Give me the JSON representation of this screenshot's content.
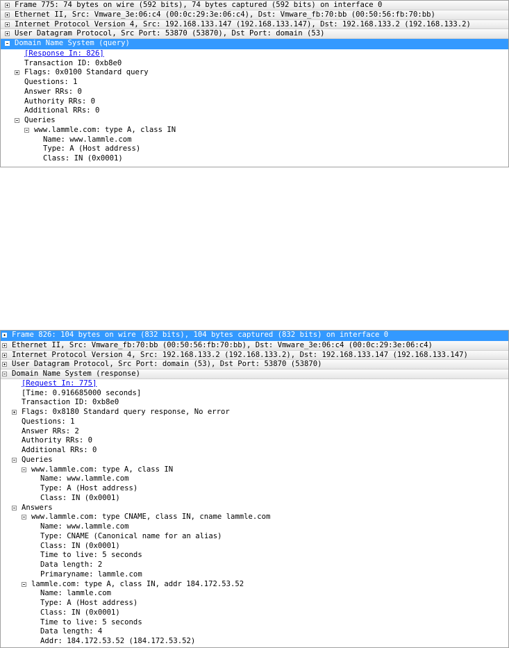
{
  "colors": {
    "selection": "#3399ff",
    "link": "#0000ee"
  },
  "icons": {
    "expand": "plus-box-icon",
    "collapse": "minus-box-icon"
  },
  "pane1": {
    "rows": [
      {
        "text": "Frame 775: 74 bytes on wire (592 bits), 74 bytes captured (592 bits) on interface 0"
      },
      {
        "text": "Ethernet II, Src: Vmware_3e:06:c4 (00:0c:29:3e:06:c4), Dst: Vmware_fb:70:bb (00:50:56:fb:70:bb)"
      },
      {
        "text": "Internet Protocol Version 4, Src: 192.168.133.147 (192.168.133.147), Dst: 192.168.133.2 (192.168.133.2)"
      },
      {
        "text": "User Datagram Protocol, Src Port: 53870 (53870), Dst Port: domain (53)"
      },
      {
        "text": "Domain Name System (query)"
      },
      {
        "text": "[Response In: 826]"
      },
      {
        "text": "Transaction ID: 0xb8e0"
      },
      {
        "text": "Flags: 0x0100 Standard query"
      },
      {
        "text": "Questions: 1"
      },
      {
        "text": "Answer RRs: 0"
      },
      {
        "text": "Authority RRs: 0"
      },
      {
        "text": "Additional RRs: 0"
      },
      {
        "text": "Queries"
      },
      {
        "text": "www.lammle.com: type A, class IN"
      },
      {
        "text": "Name: www.lammle.com"
      },
      {
        "text": "Type: A (Host address)"
      },
      {
        "text": "Class: IN (0x0001)"
      }
    ]
  },
  "pane2": {
    "rows": [
      {
        "text": "Frame 826: 104 bytes on wire (832 bits), 104 bytes captured (832 bits) on interface 0"
      },
      {
        "text": "Ethernet II, Src: Vmware_fb:70:bb (00:50:56:fb:70:bb), Dst: Vmware_3e:06:c4 (00:0c:29:3e:06:c4)"
      },
      {
        "text": "Internet Protocol Version 4, Src: 192.168.133.2 (192.168.133.2), Dst: 192.168.133.147 (192.168.133.147)"
      },
      {
        "text": "User Datagram Protocol, Src Port: domain (53), Dst Port: 53870 (53870)"
      },
      {
        "text": "Domain Name System (response)"
      },
      {
        "text": "[Request In: 775]"
      },
      {
        "text": "[Time: 0.916685000 seconds]"
      },
      {
        "text": "Transaction ID: 0xb8e0"
      },
      {
        "text": "Flags: 0x8180 Standard query response, No error"
      },
      {
        "text": "Questions: 1"
      },
      {
        "text": "Answer RRs: 2"
      },
      {
        "text": "Authority RRs: 0"
      },
      {
        "text": "Additional RRs: 0"
      },
      {
        "text": "Queries"
      },
      {
        "text": "www.lammle.com: type A, class IN"
      },
      {
        "text": "Name: www.lammle.com"
      },
      {
        "text": "Type: A (Host address)"
      },
      {
        "text": "Class: IN (0x0001)"
      },
      {
        "text": "Answers"
      },
      {
        "text": "www.lammle.com: type CNAME, class IN, cname lammle.com"
      },
      {
        "text": "Name: www.lammle.com"
      },
      {
        "text": "Type: CNAME (Canonical name for an alias)"
      },
      {
        "text": "Class: IN (0x0001)"
      },
      {
        "text": "Time to live: 5 seconds"
      },
      {
        "text": "Data length: 2"
      },
      {
        "text": "Primaryname: lammle.com"
      },
      {
        "text": "lammle.com: type A, class IN, addr 184.172.53.52"
      },
      {
        "text": "Name: lammle.com"
      },
      {
        "text": "Type: A (Host address)"
      },
      {
        "text": "Class: IN (0x0001)"
      },
      {
        "text": "Time to live: 5 seconds"
      },
      {
        "text": "Data length: 4"
      },
      {
        "text": "Addr: 184.172.53.52 (184.172.53.52)"
      }
    ]
  }
}
